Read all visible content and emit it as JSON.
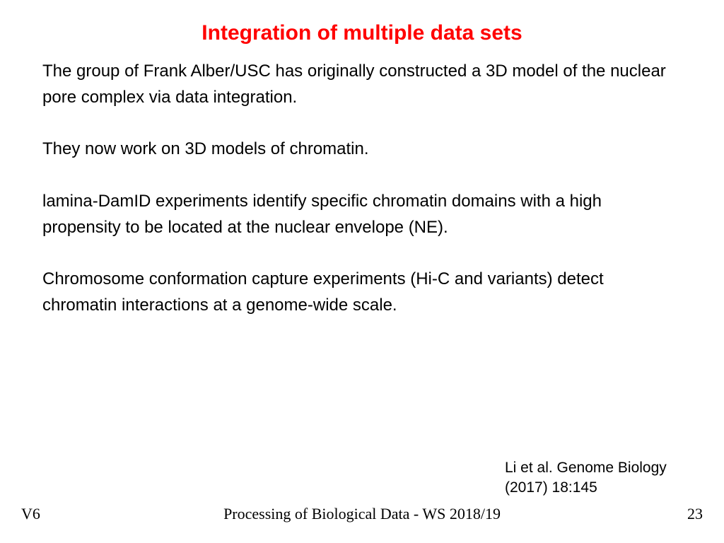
{
  "title": "Integration of multiple data sets",
  "paragraphs": {
    "p1": "The group of Frank Alber/USC has originally constructed a 3D model of the nuclear pore complex via data integration.",
    "p2": "They now work on 3D models of chromatin.",
    "p3": "lamina-DamID experiments identify specific chromatin domains with a high propensity to be located at the nuclear envelope (NE).",
    "p4": "Chromosome conformation capture experiments (Hi-C and variants) detect chromatin interactions at a genome-wide scale."
  },
  "citation": "Li et al. Genome Biology (2017) 18:145",
  "footer": {
    "left": "V6",
    "center": "Processing of Biological Data - WS 2018/19",
    "right": "23"
  }
}
